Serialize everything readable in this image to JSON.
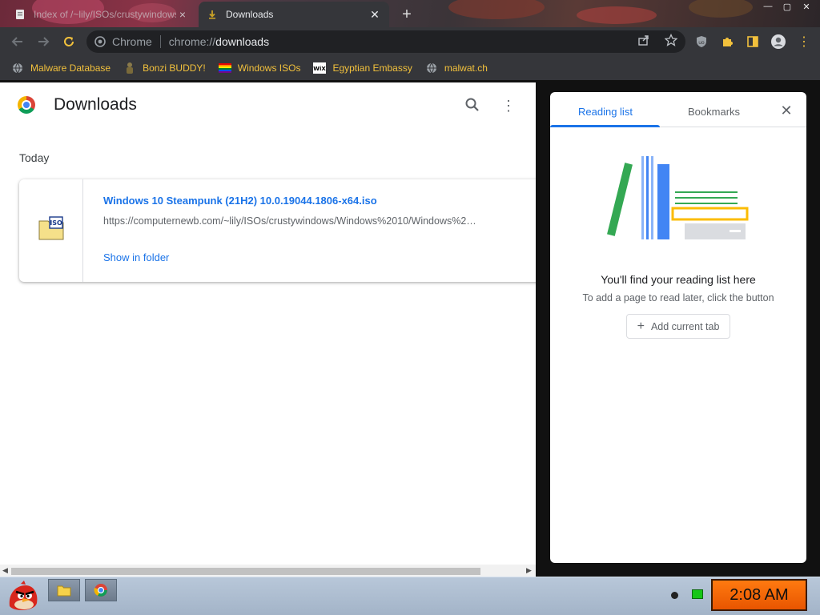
{
  "tabs": [
    {
      "title": "Index of /~lily/ISOs/crustywindows",
      "active": false
    },
    {
      "title": "Downloads",
      "active": true
    }
  ],
  "toolbar": {
    "site_chip": "Chrome",
    "url_prefix": "chrome://",
    "url_path": "downloads"
  },
  "bookmarks": [
    {
      "label": "Malware Database",
      "icon": "globe-icon"
    },
    {
      "label": "Bonzi BUDDY!",
      "icon": "bonzi-icon"
    },
    {
      "label": "Windows ISOs",
      "icon": "rainbow-flag-icon"
    },
    {
      "label": "Egyptian Embassy",
      "icon": "wix-icon"
    },
    {
      "label": "malwat.ch",
      "icon": "globe-icon"
    }
  ],
  "downloads": {
    "title": "Downloads",
    "section": "Today",
    "item": {
      "file_name": "Windows 10 Steampunk (21H2) 10.0.19044.1806-x64.iso",
      "url": "https://computernewb.com/~lily/ISOs/crustywindows/Windows%2010/Windows%2…",
      "action": "Show in folder",
      "icon_label": "ISO"
    }
  },
  "side_panel": {
    "tab_reading": "Reading list",
    "tab_bookmarks": "Bookmarks",
    "empty_title": "You'll find your reading list here",
    "empty_subtitle": "To add a page to read later, click the button",
    "add_button": "Add current tab"
  },
  "taskbar": {
    "clock": "2:08 AM"
  },
  "colors": {
    "accent": "#1a73e8",
    "bookmark_text": "#f2c13c",
    "toolbar_bg": "#35363a",
    "clock_bg": "#ff7a10"
  }
}
